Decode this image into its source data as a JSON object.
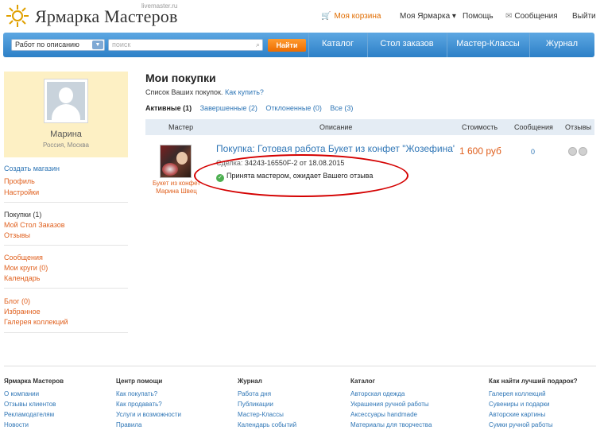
{
  "header": {
    "logo_sub": "livemaster.ru",
    "logo_text": "Ярмарка Мастеров",
    "cart": "Моя корзина",
    "my_fair": "Моя Ярмарка",
    "help": "Помощь",
    "messages": "Сообщения",
    "exit": "Выйти"
  },
  "searchbar": {
    "select_value": "Работ по описанию",
    "placeholder": "поиск",
    "find_label": "Найти",
    "nav": [
      "Каталог",
      "Стол заказов",
      "Мастер-Классы",
      "Журнал"
    ]
  },
  "profile": {
    "name": "Марина",
    "location": "Россия, Москва"
  },
  "sidebar": {
    "group1": [
      "Создать магазин",
      "Профиль",
      "Настройки"
    ],
    "group2": [
      "Покупки (1)",
      "Мой Стол Заказов",
      "Отзывы"
    ],
    "group3": [
      "Сообщения",
      "Мои круги (0)",
      "Календарь"
    ],
    "group4": [
      "Блог (0)",
      "Избранное",
      "Галерея коллекций"
    ]
  },
  "main": {
    "title": "Мои покупки",
    "subtitle": "Список Ваших покупок.",
    "how_to_buy": "Как купить?",
    "tabs": [
      "Активные (1)",
      "Завершенные (2)",
      "Отклоненные (0)",
      "Все (3)"
    ],
    "columns": [
      "Мастер",
      "Описание",
      "Стоимость",
      "Сообщения",
      "Отзывы"
    ],
    "row": {
      "caption_item": "Букет из конфет",
      "caption_master": "Марина Швец",
      "title": "Покупка: Готовая работа Букет из конфет \"Жозефина\"",
      "deal_label": "Сделка:",
      "deal_value": "34243-16550F-2 от 18.08.2015",
      "status": "Принята мастером, ожидает Вашего отзыва",
      "price": "1 600 руб",
      "messages": "0"
    }
  },
  "footer": {
    "cols": [
      {
        "title": "Ярмарка Мастеров",
        "links": [
          "О компании",
          "Отзывы клиентов",
          "Рекламодателям",
          "Новости"
        ]
      },
      {
        "title": "Центр помощи",
        "links": [
          "Как покупать?",
          "Как продавать?",
          "Услуги и возможности",
          "Правила"
        ]
      },
      {
        "title": "Журнал",
        "links": [
          "Работа дня",
          "Публикации",
          "Мастер-Классы",
          "Календарь событий"
        ]
      },
      {
        "title": "Каталог",
        "links": [
          "Авторская одежда",
          "Украшения ручной работы",
          "Аксессуары handmade",
          "Материалы для творчества"
        ]
      },
      {
        "title": "Как найти лучший подарок?",
        "links": [
          "Галерея коллекций",
          "Сувениры и подарки",
          "Авторские картины",
          "Сумки ручной работы"
        ]
      }
    ]
  },
  "colors": {
    "accent": "#e0601e",
    "link": "#2f76b6",
    "nav": "#2d80c7",
    "annotation": "#d40000"
  }
}
